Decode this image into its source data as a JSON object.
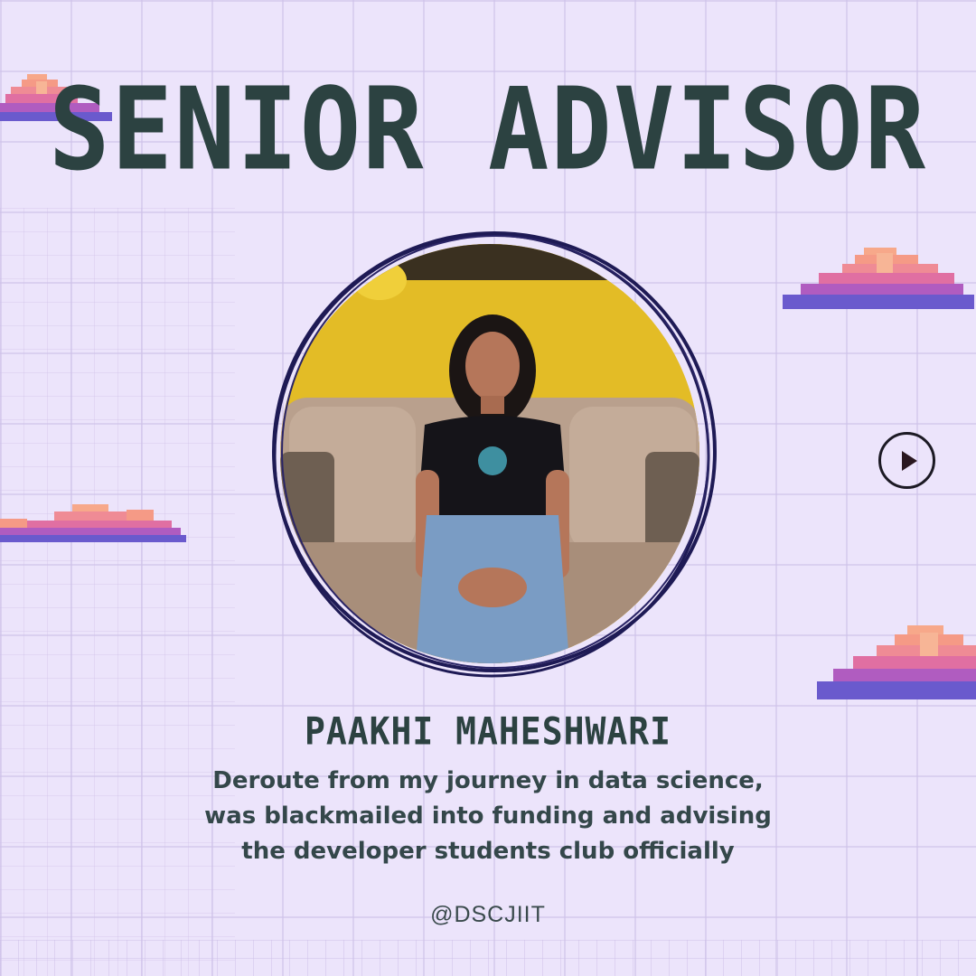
{
  "poster": {
    "title": "SENIOR ADVISOR",
    "name": "PAAKHI MAHESHWARI",
    "bio_lines": [
      "Deroute from my journey in data science,",
      "was blackmailed into funding and advising",
      "the developer students club officially"
    ],
    "handle": "@DSCJIIT"
  },
  "icons": {
    "play": "play-icon",
    "cloud": "pixel-cloud-icon"
  },
  "colors": {
    "background": "#ece4fb",
    "text_primary": "#2c4241",
    "ring": "#1e1a55",
    "cloud_top": "#f59a86",
    "cloud_mid": "#e06fa2",
    "cloud_base": "#6a5acd"
  }
}
